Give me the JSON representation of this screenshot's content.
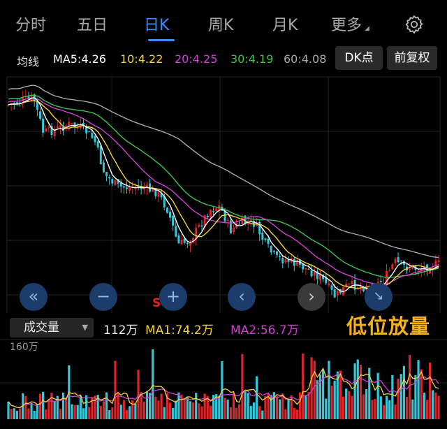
{
  "tabs": [
    {
      "label": "分时",
      "active": false
    },
    {
      "label": "五日",
      "active": false
    },
    {
      "label": "日K",
      "active": true
    },
    {
      "label": "周K",
      "active": false
    },
    {
      "label": "月K",
      "active": false
    },
    {
      "label": "更多",
      "active": false
    }
  ],
  "more_arrow": "◢",
  "settings_icon": "gear-icon",
  "ma_bar": {
    "title": "均线",
    "items": [
      {
        "label": "MA5:4.26",
        "color": "#ffffff"
      },
      {
        "label": "10:4.22",
        "color": "#f5d23a"
      },
      {
        "label": "20:4.25",
        "color": "#d040d0"
      },
      {
        "label": "30:4.19",
        "color": "#3fc24a"
      },
      {
        "label": "60:4.08",
        "color": "#a9a9a9"
      }
    ],
    "dk_button": "DK点",
    "adjust_button": "前复权"
  },
  "controls": {
    "first": "«",
    "zoom_out": "−",
    "zoom_in": "+",
    "prev": "‹",
    "next": "›",
    "fit": "↘"
  },
  "signal_mark": "S",
  "volume": {
    "selector": "成交量",
    "selector_arrow": "▼",
    "current": "112万",
    "ma1": "MA1:74.2万",
    "ma2": "MA2:56.7万",
    "ma1_color": "#f5d23a",
    "ma2_color": "#d040d0",
    "scale": "160万"
  },
  "caption": "低位放量",
  "colors": {
    "up": "#e0242a",
    "down": "#36c6d8",
    "ma5": "#ffffff",
    "ma10": "#f5d23a",
    "ma20": "#d040d0",
    "ma30": "#3fc24a",
    "ma60": "#a9a9a9"
  }
}
